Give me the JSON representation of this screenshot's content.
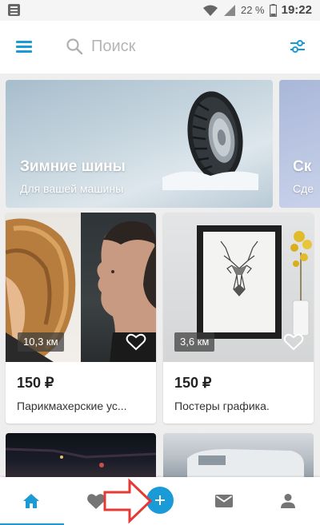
{
  "status_bar": {
    "battery_percent": "22 %",
    "time": "19:22"
  },
  "search": {
    "placeholder": "Поиск"
  },
  "banners": [
    {
      "title": "Зимние шины",
      "subtitle": "Для вашей машины"
    },
    {
      "title": "Ск",
      "subtitle": "Сде"
    }
  ],
  "listings": [
    {
      "price": "150 ₽",
      "title": "Парикмахерские ус...",
      "distance": "10,3 км"
    },
    {
      "price": "150 ₽",
      "title": "Постеры графика.",
      "distance": "3,6 км"
    }
  ],
  "colors": {
    "accent": "#1a9bd7",
    "background": "#eeeeee"
  },
  "icons": {
    "menu": "menu-icon",
    "search": "search-icon",
    "filter": "filter-icon",
    "favorite": "heart-icon",
    "home": "home-icon",
    "add": "plus-icon",
    "messages": "mail-icon",
    "profile": "person-icon"
  }
}
